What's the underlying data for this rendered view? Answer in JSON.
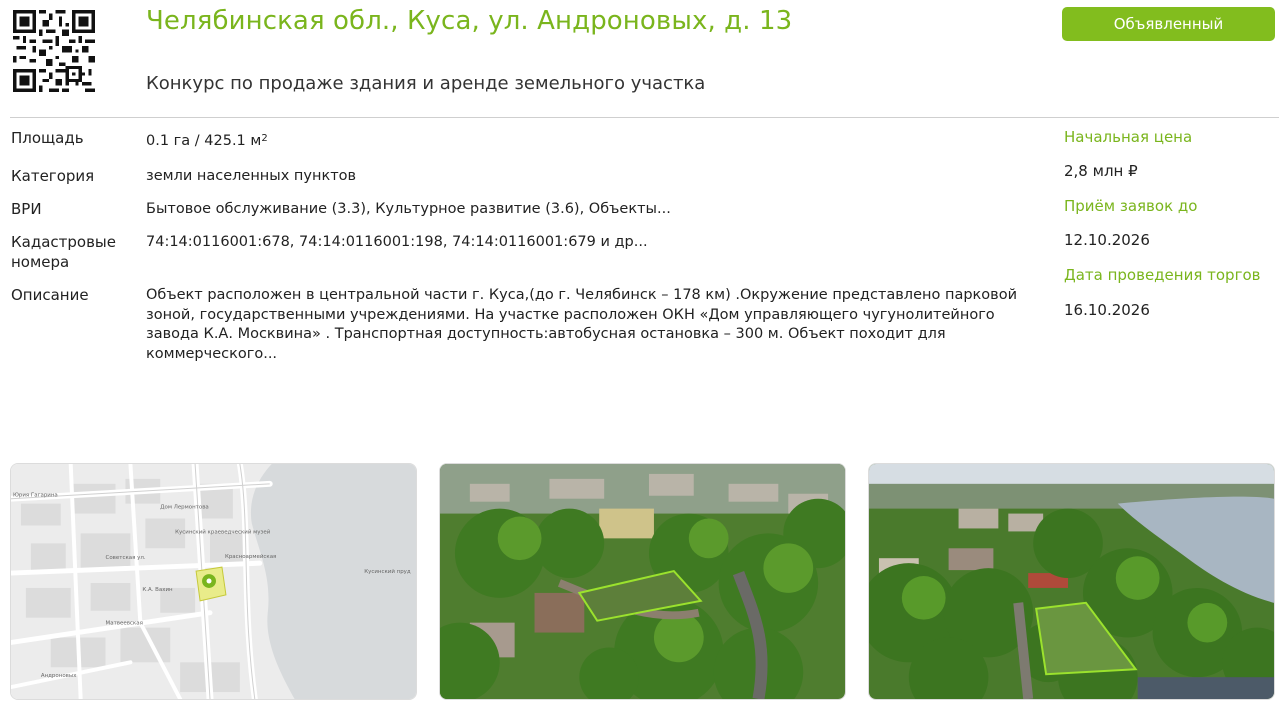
{
  "header": {
    "title": "Челябинская обл., Куса, ул. Андроновых, д. 13",
    "subtitle": "Конкурс по продаже здания и аренде земельного участка",
    "status": "Объявленный",
    "accent_color": "#7ab51d",
    "badge_color": "#82bd1e"
  },
  "details": {
    "area": {
      "label": "Площадь",
      "value": "0.1 га / 425.1 м",
      "unit_sup": "2"
    },
    "category": {
      "label": "Категория",
      "value": "земли населенных пунктов"
    },
    "vri": {
      "label": "ВРИ",
      "value": "Бытовое обслуживание (3.3), Культурное развитие (3.6), Объекты..."
    },
    "cadastral": {
      "label_line1": "Кадастровые",
      "label_line2": "номера",
      "value": "74:14:0116001:678, 74:14:0116001:198, 74:14:0116001:679 и др..."
    },
    "description": {
      "label": "Описание",
      "value": "Объект расположен в центральной части г. Куса,(до г. Челябинск – 178 км) .Окружение представлено парковой зоной, государственными учреждениями. На участке расположен ОКН «Дом управляющего чугунолитейного завода К.А. Москвина» . Транспортная доступность:автобусная остановка – 300 м. Объект походит для коммерческого..."
    }
  },
  "sidebar": {
    "start_price_label": "Начальная цена",
    "start_price": "2,8 млн ₽",
    "deadline_label": "Приём заявок до",
    "deadline": "12.10.2026",
    "auction_date_label": "Дата проведения торгов",
    "auction_date": "16.10.2026"
  },
  "map_labels": {
    "street1": "Юрия Гагарина",
    "street2": "Советская ул.",
    "street3": "Красноармейская",
    "pond": "Кусинский пруд",
    "poi1": "Дом Лермонтова",
    "poi2": "Кусинский краеведческий музей",
    "poi3": "К.А. Вахин",
    "street4": "Андроновых",
    "street5": "Матвеевская"
  },
  "icons": {
    "qr": "qr-code-icon",
    "map_pin": "map-pin-icon"
  }
}
